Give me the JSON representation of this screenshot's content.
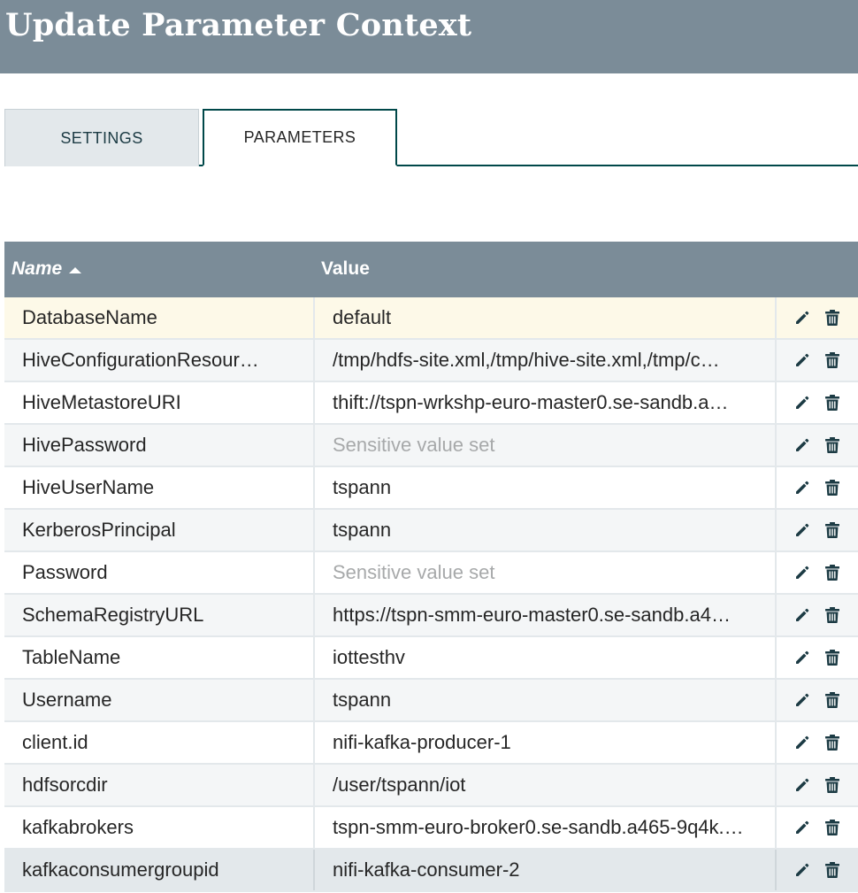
{
  "dialog": {
    "title": "Update Parameter Context"
  },
  "tabs": [
    {
      "label": "SETTINGS",
      "active": false
    },
    {
      "label": "PARAMETERS",
      "active": true
    }
  ],
  "grid": {
    "columns": {
      "name": "Name",
      "value": "Value"
    },
    "sort": {
      "column": "Name",
      "direction": "ascending"
    },
    "rows": [
      {
        "name": "DatabaseName",
        "value": "default",
        "sensitive": false
      },
      {
        "name": "HiveConfigurationResour…",
        "value": "/tmp/hdfs-site.xml,/tmp/hive-site.xml,/tmp/c…",
        "sensitive": false
      },
      {
        "name": "HiveMetastoreURI",
        "value": "thift://tspn-wrkshp-euro-master0.se-sandb.a…",
        "sensitive": false
      },
      {
        "name": "HivePassword",
        "value": "Sensitive value set",
        "sensitive": true
      },
      {
        "name": "HiveUserName",
        "value": "tspann",
        "sensitive": false
      },
      {
        "name": "KerberosPrincipal",
        "value": "tspann",
        "sensitive": false
      },
      {
        "name": "Password",
        "value": "Sensitive value set",
        "sensitive": true
      },
      {
        "name": "SchemaRegistryURL",
        "value": "https://tspn-smm-euro-master0.se-sandb.a4…",
        "sensitive": false
      },
      {
        "name": "TableName",
        "value": "iottesthv",
        "sensitive": false
      },
      {
        "name": "Username",
        "value": "tspann",
        "sensitive": false
      },
      {
        "name": "client.id",
        "value": "nifi-kafka-producer-1",
        "sensitive": false
      },
      {
        "name": "hdfsorcdir",
        "value": "/user/tspann/iot",
        "sensitive": false
      },
      {
        "name": "kafkabrokers",
        "value": "tspn-smm-euro-broker0.se-sandb.a465-9q4k.…",
        "sensitive": false
      },
      {
        "name": "kafkaconsumergroupid",
        "value": "nifi-kafka-consumer-2",
        "sensitive": false
      }
    ],
    "row_actions": [
      "pencil-icon",
      "trash-icon"
    ]
  },
  "colors": {
    "header_bg": "#7b8c98",
    "tab_accent": "#004849",
    "selected_row": "#fdf9e8",
    "icon": "#1c3b44",
    "sensitive_text": "#a7a9aa"
  }
}
